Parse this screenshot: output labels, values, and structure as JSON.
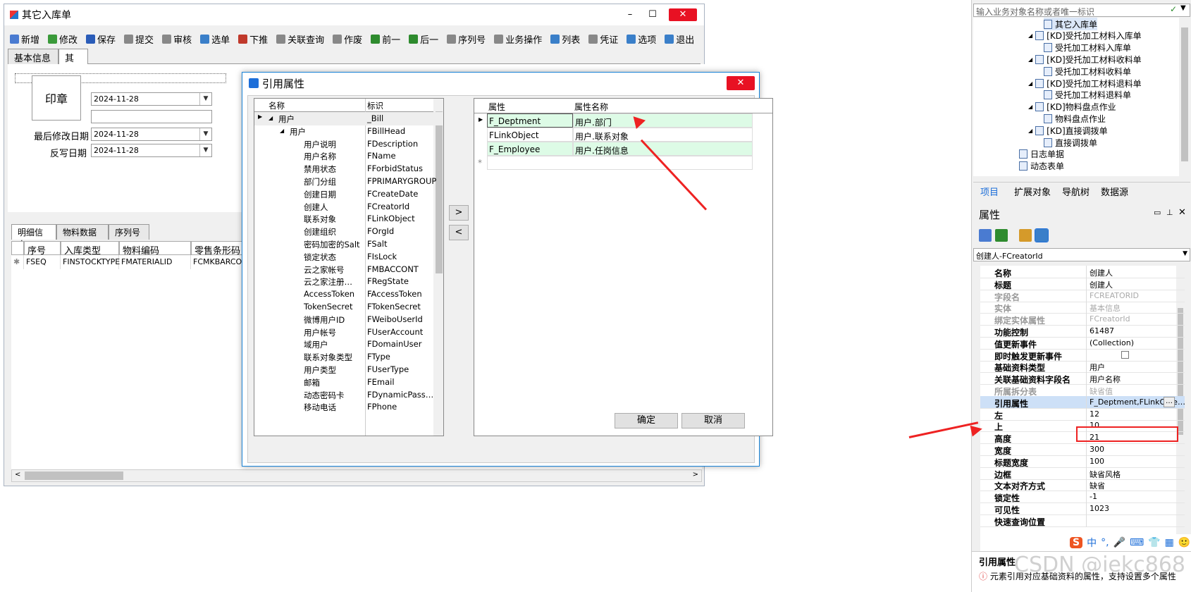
{
  "main_window": {
    "title": "其它入库单",
    "toolbar": [
      "新增",
      "修改",
      "保存",
      "提交",
      "审核",
      "选单",
      "下推",
      "关联查询",
      "作废",
      "前一",
      "后一",
      "序列号",
      "业务操作",
      "列表",
      "凭证",
      "选项",
      "退出"
    ],
    "toolbar_colors": [
      "#4a7bd1",
      "#3a9a3a",
      "#2a5cb8",
      "#888888",
      "#888888",
      "#3a7fc9",
      "#c0392b",
      "#888888",
      "#888888",
      "#2e8b2e",
      "#2e8b2e",
      "#888888",
      "#888888",
      "#3a7fc9",
      "#888888",
      "#3a7fc9",
      "#3a7fc9"
    ],
    "tabs": [
      "基本信息",
      "其他"
    ],
    "stamp_label": "印章",
    "date1": "2024-11-28",
    "last_modified_label": "最后修改日期",
    "last_modified_value": "2024-11-28",
    "writeback_label": "反写日期",
    "writeback_value": "2024-11-28",
    "detail_tabs": [
      "明细信息",
      "物料数据",
      "序列号"
    ],
    "grid_headers": [
      "序号",
      "入库类型",
      "物料编码",
      "零售条形码"
    ],
    "grid_row": [
      "FSEQ",
      "FINSTOCKTYPE",
      "FMATERIALID",
      "FCMKBARCODE"
    ]
  },
  "dialog": {
    "title": "引用属性",
    "left_headers": [
      "名称",
      "标识"
    ],
    "left_rows": [
      {
        "name": "用户",
        "id": "_Bill",
        "level": 0
      },
      {
        "name": "用户",
        "id": "FBillHead",
        "level": 1
      },
      {
        "name": "用户说明",
        "id": "FDescription",
        "level": 2
      },
      {
        "name": "用户名称",
        "id": "FName",
        "level": 2
      },
      {
        "name": "禁用状态",
        "id": "FForbidStatus",
        "level": 2
      },
      {
        "name": "部门分组",
        "id": "FPRIMARYGROUP",
        "level": 2
      },
      {
        "name": "创建日期",
        "id": "FCreateDate",
        "level": 2
      },
      {
        "name": "创建人",
        "id": "FCreatorId",
        "level": 2
      },
      {
        "name": "联系对象",
        "id": "FLinkObject",
        "level": 2
      },
      {
        "name": "创建组织",
        "id": "FOrgId",
        "level": 2
      },
      {
        "name": "密码加密的Salt",
        "id": "FSalt",
        "level": 2
      },
      {
        "name": "锁定状态",
        "id": "FIsLock",
        "level": 2
      },
      {
        "name": "云之家帐号",
        "id": "FMBACCONT",
        "level": 2
      },
      {
        "name": "云之家注册…",
        "id": "FRegState",
        "level": 2
      },
      {
        "name": "AccessToken",
        "id": "FAccessToken",
        "level": 2
      },
      {
        "name": "TokenSecret",
        "id": "FTokenSecret",
        "level": 2
      },
      {
        "name": "微博用户ID",
        "id": "FWeiboUserId",
        "level": 2
      },
      {
        "name": "用户帐号",
        "id": "FUserAccount",
        "level": 2
      },
      {
        "name": "域用户",
        "id": "FDomainUser",
        "level": 2
      },
      {
        "name": "联系对象类型",
        "id": "FType",
        "level": 2
      },
      {
        "name": "用户类型",
        "id": "FUserType",
        "level": 2
      },
      {
        "name": "邮箱",
        "id": "FEmail",
        "level": 2
      },
      {
        "name": "动态密码卡",
        "id": "FDynamicPass…",
        "level": 2
      },
      {
        "name": "移动电话",
        "id": "FPhone",
        "level": 2
      }
    ],
    "move_right": ">",
    "move_left": "<",
    "right_headers": [
      "属性",
      "属性名称"
    ],
    "right_rows": [
      {
        "prop": "F_Deptment",
        "name": "用户.部门"
      },
      {
        "prop": "FLinkObject",
        "name": "用户.联系对象"
      },
      {
        "prop": "F_Employee",
        "name": "用户.任岗信息"
      }
    ],
    "new_row_marker": "*",
    "ok": "确定",
    "cancel": "取消"
  },
  "right_panel": {
    "search_placeholder": "输入业务对象名称或者唯一标识",
    "tree": [
      {
        "label": "其它入库单",
        "indent": 2,
        "expand": false
      },
      {
        "label": "[KD]受托加工材料入库单",
        "indent": 1,
        "expand": true
      },
      {
        "label": "受托加工材料入库单",
        "indent": 2,
        "expand": false
      },
      {
        "label": "[KD]受托加工材料收料单",
        "indent": 1,
        "expand": true
      },
      {
        "label": "受托加工材料收料单",
        "indent": 2,
        "expand": false
      },
      {
        "label": "[KD]受托加工材料退料单",
        "indent": 1,
        "expand": true
      },
      {
        "label": "受托加工材料退料单",
        "indent": 2,
        "expand": false
      },
      {
        "label": "[KD]物料盘点作业",
        "indent": 1,
        "expand": true
      },
      {
        "label": "物料盘点作业",
        "indent": 2,
        "expand": false
      },
      {
        "label": "[KD]直接调拨单",
        "indent": 1,
        "expand": true
      },
      {
        "label": "直接调拨单",
        "indent": 2,
        "expand": false
      },
      {
        "label": "日志单据",
        "indent": 0,
        "expand": false
      },
      {
        "label": "动态表单",
        "indent": 0,
        "expand": false
      }
    ],
    "tabs": [
      "项目",
      "扩展对象",
      "导航树",
      "数据源"
    ],
    "props_title": "属性",
    "selected_object": "创建人-FCreatorId",
    "props": [
      {
        "k": "名称",
        "v": "创建人",
        "dim": false
      },
      {
        "k": "标题",
        "v": "创建人",
        "dim": false
      },
      {
        "k": "字段名",
        "v": "FCREATORID",
        "dim": true
      },
      {
        "k": "实体",
        "v": "基本信息",
        "dim": true
      },
      {
        "k": "绑定实体属性",
        "v": "FCreatorId",
        "dim": true
      },
      {
        "k": "功能控制",
        "v": "61487",
        "dim": false
      },
      {
        "k": "值更新事件",
        "v": "(Collection)",
        "dim": false
      },
      {
        "k": "即时触发更新事件",
        "v": "",
        "dim": false
      },
      {
        "k": "基础资料类型",
        "v": "用户",
        "dim": false
      },
      {
        "k": "关联基础资料字段名",
        "v": "用户名称",
        "dim": false
      },
      {
        "k": "所属拆分表",
        "v": "缺省值",
        "dim": true
      },
      {
        "k": "引用属性",
        "v": "F_Deptment,FLinkObje…",
        "dim": false
      },
      {
        "k": "左",
        "v": "12",
        "dim": false
      },
      {
        "k": "上",
        "v": "10",
        "dim": false
      },
      {
        "k": "高度",
        "v": "21",
        "dim": false
      },
      {
        "k": "宽度",
        "v": "300",
        "dim": false
      },
      {
        "k": "标题宽度",
        "v": "100",
        "dim": false
      },
      {
        "k": "边框",
        "v": "缺省风格",
        "dim": false
      },
      {
        "k": "文本对齐方式",
        "v": "缺省",
        "dim": false
      },
      {
        "k": "锁定性",
        "v": "-1",
        "dim": false
      },
      {
        "k": "可见性",
        "v": "1023",
        "dim": false
      },
      {
        "k": "快速查询位置",
        "v": "",
        "dim": false
      }
    ],
    "desc_title": "引用属性",
    "desc_text": "元素引用对应基础资料的属性，支持设置多个属性",
    "watermark": "CSDN @iekc868",
    "ime": [
      "S",
      "中",
      "°,",
      "🎤",
      "⌨",
      "👕",
      "▦",
      "🙂"
    ]
  },
  "colors": {
    "highlight_green": "#ddfbe6",
    "annotation_red": "#ee2222",
    "accent_blue": "#1883d7"
  }
}
